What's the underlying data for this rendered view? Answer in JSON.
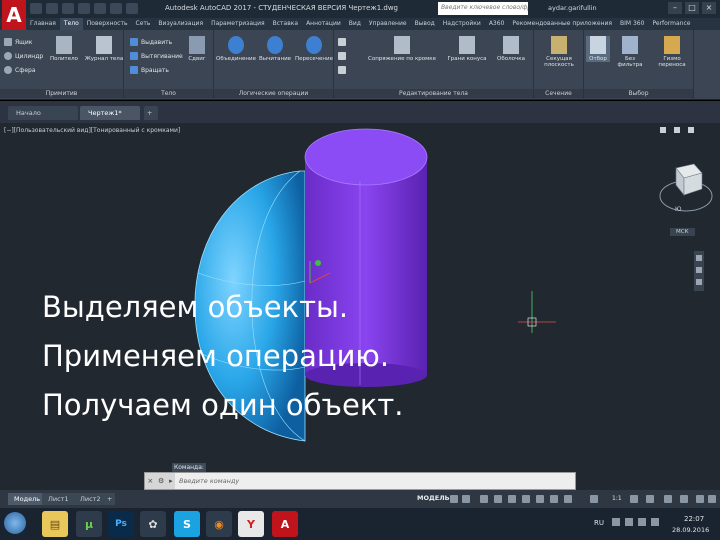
{
  "app": {
    "logo": "A",
    "window_title": "Autodesk AutoCAD 2017 - СТУДЕНЧЕСКАЯ ВЕРСИЯ   Чертеж1.dwg",
    "search_placeholder": "Введите ключевое слово/фразу",
    "user": "aydar.garifullin"
  },
  "ribbon_tabs": [
    "Главная",
    "Тело",
    "Поверхность",
    "Сеть",
    "Визуализация",
    "Параметризация",
    "Вставка",
    "Аннотации",
    "Вид",
    "Управление",
    "Вывод",
    "Надстройки",
    "A360",
    "Рекомендованные приложения",
    "BIM 360",
    "Performance"
  ],
  "ribbon": {
    "primitive": {
      "title": "Примитив",
      "box": "Ящик",
      "cylinder": "Цилиндр",
      "sphere": "Сфера",
      "polysolid": "Политело"
    },
    "solid": {
      "title": "Тело",
      "journal": "Журнал тела",
      "extrude": "Выдавить",
      "loft": "Вытягивание",
      "revolve": "Вращать",
      "sweep": "Сдвиг"
    },
    "boolean": {
      "title": "Логические операции",
      "union": "Объединение",
      "subtract": "Вычитание",
      "intersect": "Пересечение"
    },
    "edit": {
      "title": "Редактирование тела",
      "fillet": "Сопряжение по кромке",
      "cone_faces": "Грани конуса",
      "shell": "Оболочка"
    },
    "section": {
      "title": "Сечение",
      "plane": "Секущая плоскость"
    },
    "selection": {
      "title": "Выбор",
      "cull": "Отбор",
      "no_filter": "Без фильтра",
      "gizmo": "Гизмо переноса"
    }
  },
  "doc_tabs": [
    "Начало",
    "Чертеж1*",
    "+"
  ],
  "viewport": {
    "label": "[−][Пользовательский вид][Тонированный с кромками]",
    "viewcube_label": "Ю",
    "mcs_label": "МСК"
  },
  "overlay_lines": [
    "Выделяем объекты.",
    "Применяем операцию.",
    "Получаем один объект."
  ],
  "command": {
    "label": "Команда:",
    "placeholder": "Введите команду"
  },
  "layout_tabs": [
    "Модель",
    "Лист1",
    "Лист2",
    "+"
  ],
  "status": {
    "model": "МОДЕЛЬ",
    "scale": "1:1"
  },
  "taskbar": {
    "lang": "RU",
    "time": "22:07",
    "date": "28.09.2016"
  },
  "colors": {
    "sphere": "#29a6e8",
    "cylinder": "#7a33e0",
    "viewport_bg": "#212830",
    "ribbon_bg": "#3b4553",
    "autocad_red": "#c0141d"
  }
}
